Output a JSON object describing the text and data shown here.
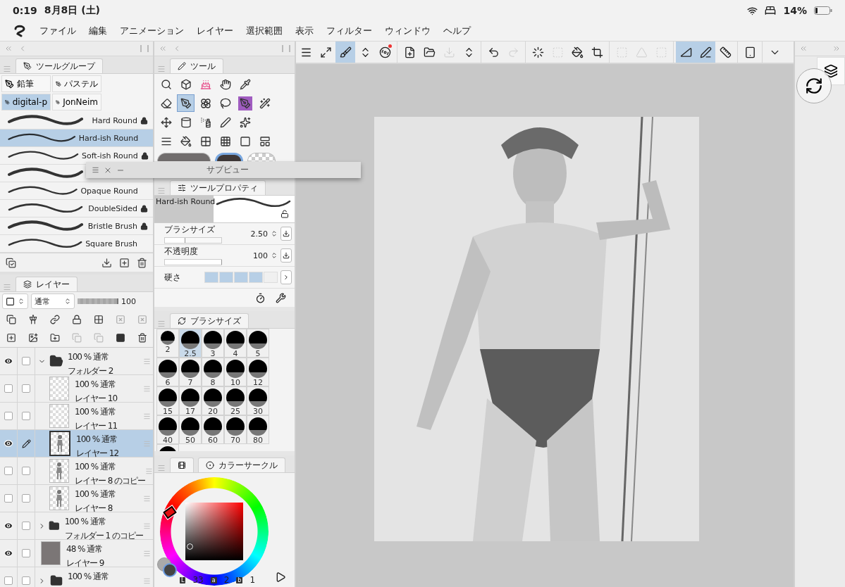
{
  "status_bar": {
    "time": "0:19",
    "date": "8月8日 (土)",
    "battery": "14%"
  },
  "menu": [
    "ファイル",
    "編集",
    "アニメーション",
    "レイヤー",
    "選択範囲",
    "表示",
    "フィルター",
    "ウィンドウ",
    "ヘルプ"
  ],
  "tool_group_panel": {
    "tab": "ツールグループ",
    "groups": [
      {
        "label": "鉛筆",
        "selected": false
      },
      {
        "label": "パステル",
        "selected": false
      },
      {
        "label": "digital-p",
        "selected": true
      },
      {
        "label": "JonNeim",
        "selected": false
      }
    ],
    "brushes": [
      {
        "name": "Hard Round",
        "locked": true,
        "selected": false
      },
      {
        "name": "Hard-ish Round",
        "locked": false,
        "selected": true
      },
      {
        "name": "Soft-ish Round",
        "locked": true,
        "selected": false
      },
      {
        "locked": false,
        "selected": false
      },
      {
        "name": "Opaque Round",
        "locked": false,
        "selected": false
      },
      {
        "name": "DoubleSided",
        "locked": true,
        "selected": false
      },
      {
        "name": "Bristle Brush",
        "locked": true,
        "selected": false
      },
      {
        "name": "Square Brush",
        "locked": false,
        "selected": false
      }
    ]
  },
  "subview": {
    "title": "サブビュー"
  },
  "layer_panel": {
    "tab": "レイヤー",
    "blend_mode": "通常",
    "opacity": "100",
    "opacity_slider": {
      "level": 0.97
    },
    "layers": [
      {
        "kind": "folder",
        "visible": true,
        "editing": false,
        "expanded": true,
        "selected": false,
        "blend": "100 % 通常",
        "name": "フォルダー 2",
        "children": [
          {
            "kind": "blank",
            "visible": false,
            "editing": false,
            "selected": false,
            "blend": "100 % 通常",
            "name": "レイヤー 10"
          },
          {
            "kind": "blank",
            "visible": false,
            "editing": false,
            "selected": false,
            "blend": "100 % 通常",
            "name": "レイヤー 11"
          },
          {
            "kind": "sketch",
            "visible": true,
            "editing": true,
            "selected": true,
            "blend": "100 % 通常",
            "name": "レイヤー 12"
          },
          {
            "kind": "sketch",
            "visible": false,
            "editing": false,
            "selected": false,
            "blend": "100 % 通常",
            "name": "レイヤー 8 のコピー"
          },
          {
            "kind": "sketch",
            "visible": false,
            "editing": false,
            "selected": false,
            "blend": "100 % 通常",
            "name": "レイヤー 8"
          }
        ]
      },
      {
        "kind": "folder",
        "visible": true,
        "editing": false,
        "expanded": false,
        "selected": false,
        "blend": "100 % 通常",
        "name": "フォルダー 1 のコピー"
      },
      {
        "kind": "fill",
        "visible": true,
        "editing": false,
        "selected": false,
        "blend": "48 % 通常",
        "name": "レイヤー 9"
      },
      {
        "kind": "folder",
        "visible": false,
        "editing": false,
        "expanded": false,
        "selected": false,
        "blend": "100 % 通常"
      }
    ]
  },
  "tool_panel": {
    "tab": "ツール",
    "tool_rows": [
      {
        "tools": [
          {
            "selected": false
          },
          {
            "selected": false
          },
          {
            "selected": false
          },
          {
            "selected": false
          },
          {
            "selected": false
          }
        ]
      },
      {
        "tools": [
          {
            "selected": false
          },
          {
            "selected": true
          },
          {
            "selected": false
          },
          {
            "selected": false
          },
          {
            "selected": false
          },
          {
            "selected": false
          }
        ]
      },
      {
        "tools": [
          {
            "selected": false
          },
          {
            "selected": false
          },
          {
            "selected": false
          },
          {
            "selected": false
          },
          {
            "selected": false
          }
        ]
      },
      {
        "tools": [
          {
            "selected": false
          },
          {
            "selected": false
          },
          {
            "selected": false
          },
          {
            "selected": false
          },
          {
            "selected": false
          },
          {
            "selected": false
          }
        ]
      }
    ],
    "swatches": [
      {
        "kind": "color",
        "color": "#716d6d",
        "selected": false
      },
      {
        "kind": "color",
        "color": "#3e3838",
        "selected": true
      },
      {
        "kind": "transparent",
        "selected": false
      }
    ]
  },
  "tool_property": {
    "tab": "ツールプロパティ",
    "brush": "Hard-ish Round",
    "params": [
      {
        "kind": "slider",
        "label": "ブラシサイズ",
        "value": "2.50",
        "level": 0.35
      },
      {
        "kind": "slider",
        "label": "不透明度",
        "value": "100",
        "level": 1
      },
      {
        "kind": "segments",
        "label": "硬さ",
        "level": 0.8
      }
    ]
  },
  "brush_size": {
    "tab": "ブラシサイズ",
    "sizes": [
      {
        "label": "2",
        "selected": false
      },
      {
        "label": "2.5",
        "selected": true
      },
      {
        "label": "3",
        "selected": false
      },
      {
        "label": "4",
        "selected": false
      },
      {
        "label": "5",
        "selected": false
      },
      {
        "label": "6",
        "selected": false
      },
      {
        "label": "7",
        "selected": false
      },
      {
        "label": "8",
        "selected": false
      },
      {
        "label": "10",
        "selected": false
      },
      {
        "label": "12",
        "selected": false
      },
      {
        "label": "15",
        "selected": false
      },
      {
        "label": "17",
        "selected": false
      },
      {
        "label": "20",
        "selected": false
      },
      {
        "label": "25",
        "selected": false
      },
      {
        "label": "30",
        "selected": false
      },
      {
        "label": "40",
        "selected": false
      },
      {
        "label": "50",
        "selected": false
      },
      {
        "label": "60",
        "selected": false
      },
      {
        "label": "70",
        "selected": false
      },
      {
        "label": "80",
        "selected": false
      },
      {
        "selected": false
      }
    ]
  },
  "color_panel": {
    "tab": "カラーサークル",
    "readouts": [
      {
        "key": "L",
        "value": "33"
      },
      {
        "key": "a",
        "value": "2"
      },
      {
        "key": "b",
        "value": "1"
      }
    ]
  },
  "canvas_toolbar": {
    "buttons": [
      {
        "selected": false,
        "disabled": false
      },
      {
        "selected": false,
        "disabled": false
      },
      {
        "selected": true,
        "disabled": false
      },
      {
        "selected": false,
        "disabled": false
      },
      {
        "selected": false,
        "disabled": false
      },
      {
        "selected": false,
        "disabled": false
      },
      {
        "selected": false,
        "disabled": false
      },
      {
        "selected": false,
        "disabled": true
      },
      {
        "selected": false,
        "disabled": false
      },
      {
        "selected": false,
        "disabled": false
      },
      {
        "selected": false,
        "disabled": true
      },
      {
        "selected": false,
        "disabled": false
      },
      {
        "selected": false,
        "disabled": true
      },
      {
        "selected": false,
        "disabled": false
      },
      {
        "selected": false,
        "disabled": false
      },
      {
        "selected": false,
        "disabled": true
      },
      {
        "selected": false,
        "disabled": true
      },
      {
        "selected": false,
        "disabled": true
      },
      {
        "selected": true,
        "disabled": false
      },
      {
        "selected": true,
        "disabled": false
      },
      {
        "selected": false,
        "disabled": false
      },
      {
        "selected": false,
        "disabled": false
      },
      {
        "selected": false,
        "disabled": false
      }
    ]
  }
}
